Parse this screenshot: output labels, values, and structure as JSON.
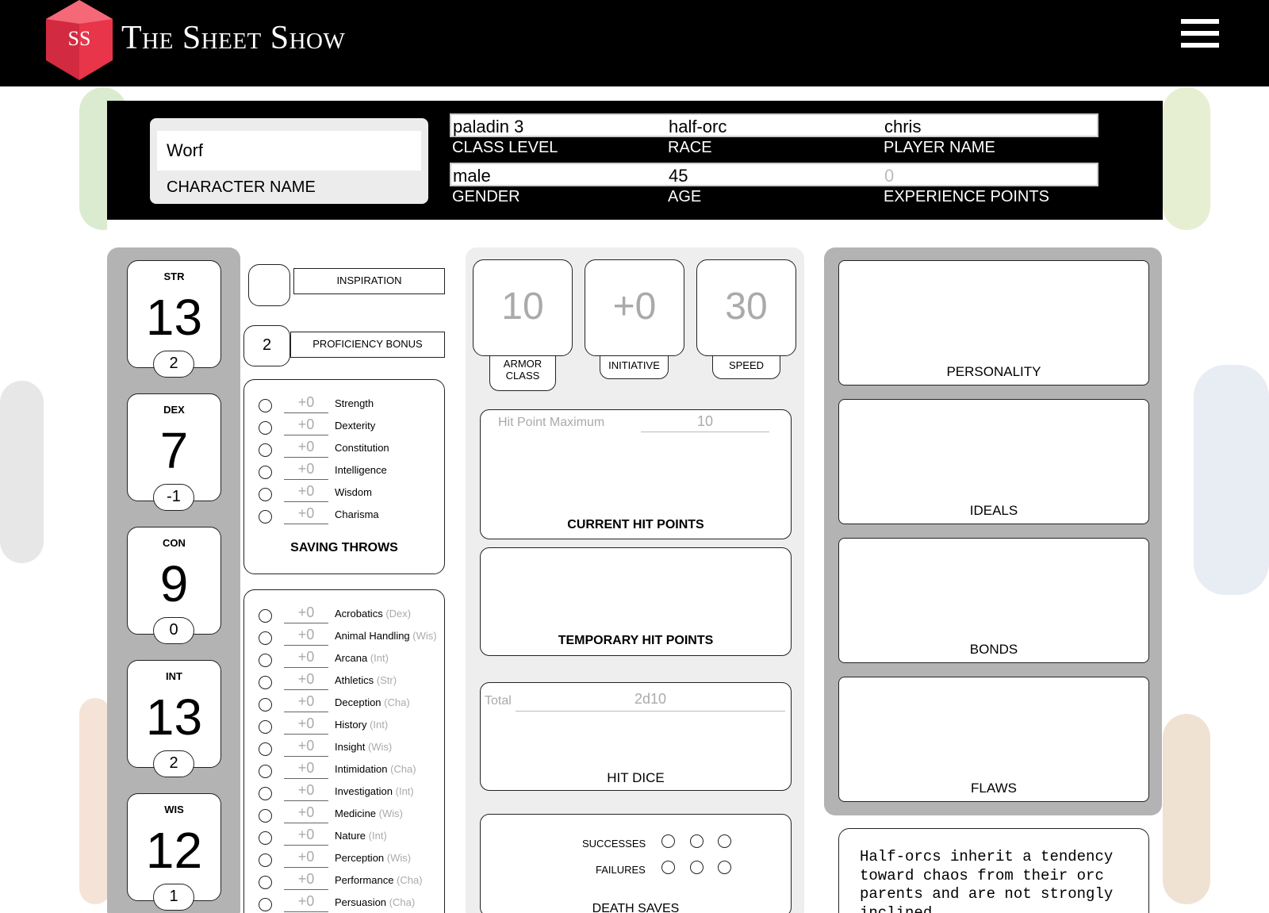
{
  "app": {
    "title": "The Sheet Show",
    "logo_text": "SS",
    "accent": "#e8354a"
  },
  "character": {
    "name": "Worf",
    "name_label": "CHARACTER NAME",
    "class_level": "paladin 3",
    "class_level_label": "CLASS LEVEL",
    "race": "half-orc",
    "race_label": "RACE",
    "player_name": "chris",
    "player_name_label": "PLAYER NAME",
    "gender": "male",
    "gender_label": "GENDER",
    "age": "45",
    "age_label": "AGE",
    "experience_points": "0",
    "experience_points_label": "EXPERIENCE POINTS"
  },
  "abilities": [
    {
      "name": "STR",
      "score": "13",
      "mod": "2"
    },
    {
      "name": "DEX",
      "score": "7",
      "mod": "-1"
    },
    {
      "name": "CON",
      "score": "9",
      "mod": "0"
    },
    {
      "name": "INT",
      "score": "13",
      "mod": "2"
    },
    {
      "name": "WIS",
      "score": "12",
      "mod": "1"
    }
  ],
  "inspiration": {
    "label": "INSPIRATION",
    "value": ""
  },
  "proficiency": {
    "label": "PROFICIENCY BONUS",
    "value": "2"
  },
  "saving_throws": {
    "title": "SAVING THROWS",
    "items": [
      {
        "mod": "+0",
        "name": "Strength"
      },
      {
        "mod": "+0",
        "name": "Dexterity"
      },
      {
        "mod": "+0",
        "name": "Constitution"
      },
      {
        "mod": "+0",
        "name": "Intelligence"
      },
      {
        "mod": "+0",
        "name": "Wisdom"
      },
      {
        "mod": "+0",
        "name": "Charisma"
      }
    ]
  },
  "skills": [
    {
      "mod": "+0",
      "name": "Acrobatics",
      "ability": "(Dex)"
    },
    {
      "mod": "+0",
      "name": "Animal Handling",
      "ability": "(Wis)"
    },
    {
      "mod": "+0",
      "name": "Arcana",
      "ability": "(Int)"
    },
    {
      "mod": "+0",
      "name": "Athletics",
      "ability": "(Str)"
    },
    {
      "mod": "+0",
      "name": "Deception",
      "ability": "(Cha)"
    },
    {
      "mod": "+0",
      "name": "History",
      "ability": "(Int)"
    },
    {
      "mod": "+0",
      "name": "Insight",
      "ability": "(Wis)"
    },
    {
      "mod": "+0",
      "name": "Intimidation",
      "ability": "(Cha)"
    },
    {
      "mod": "+0",
      "name": "Investigation",
      "ability": "(Int)"
    },
    {
      "mod": "+0",
      "name": "Medicine",
      "ability": "(Wis)"
    },
    {
      "mod": "+0",
      "name": "Nature",
      "ability": "(Int)"
    },
    {
      "mod": "+0",
      "name": "Perception",
      "ability": "(Wis)"
    },
    {
      "mod": "+0",
      "name": "Performance",
      "ability": "(Cha)"
    },
    {
      "mod": "+0",
      "name": "Persuasion",
      "ability": "(Cha)"
    }
  ],
  "combat": {
    "armor_class": {
      "value": "10",
      "label_line1": "ARMOR",
      "label_line2": "CLASS"
    },
    "initiative": {
      "value": "+0",
      "label": "INITIATIVE"
    },
    "speed": {
      "value": "30",
      "label": "SPEED"
    }
  },
  "hit_points": {
    "max_label": "Hit Point Maximum",
    "max_value": "10",
    "current_label": "CURRENT HIT POINTS",
    "temp_label": "TEMPORARY HIT POINTS"
  },
  "hit_dice": {
    "total_label": "Total",
    "total_value": "2d10",
    "label": "HIT DICE"
  },
  "death_saves": {
    "successes_label": "SUCCESSES",
    "failures_label": "FAILURES",
    "label": "DEATH SAVES"
  },
  "traits": {
    "personality_label": "PERSONALITY",
    "ideals_label": "IDEALS",
    "bonds_label": "BONDS",
    "flaws_label": "FLAWS",
    "racial_text": "Half-orcs inherit a tendency toward chaos from their orc parents and are not strongly inclined"
  }
}
